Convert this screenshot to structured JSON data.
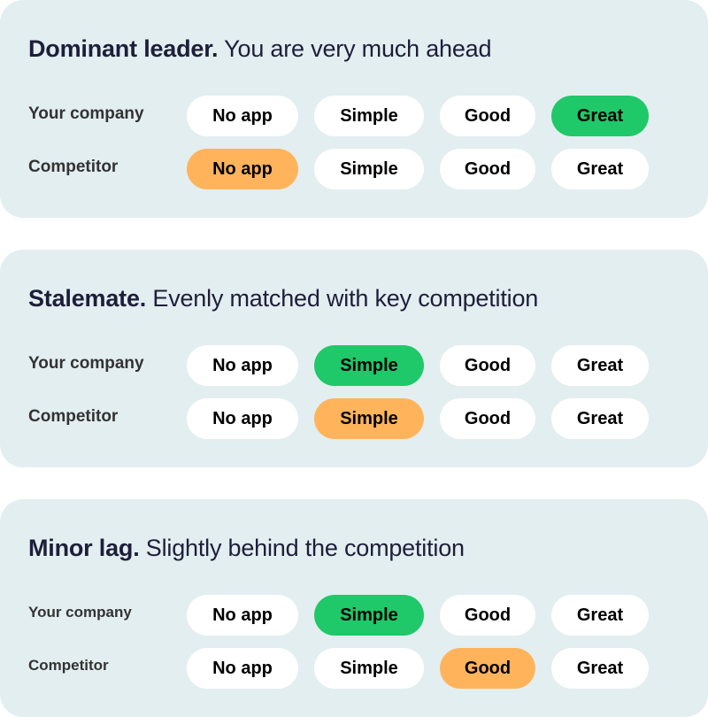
{
  "colors": {
    "panel": "#e3eef0",
    "your_company_selected": "#1fc868",
    "competitor_selected": "#ffb45c"
  },
  "options": [
    "No app",
    "Simple",
    "Good",
    "Great"
  ],
  "panels": [
    {
      "title_bold": "Dominant leader.",
      "title_rest": " You are very much ahead",
      "rows": [
        {
          "label": "Your company",
          "selected": "Great"
        },
        {
          "label": "Competitor",
          "selected": "No app"
        }
      ]
    },
    {
      "title_bold": "Stalemate.",
      "title_rest": " Evenly matched with key competition",
      "rows": [
        {
          "label": "Your company",
          "selected": "Simple"
        },
        {
          "label": "Competitor",
          "selected": "Simple"
        }
      ]
    },
    {
      "title_bold": "Minor lag.",
      "title_rest": " Slightly behind the competition",
      "rows": [
        {
          "label": "Your company",
          "selected": "Simple"
        },
        {
          "label": "Competitor",
          "selected": "Good"
        }
      ]
    }
  ]
}
